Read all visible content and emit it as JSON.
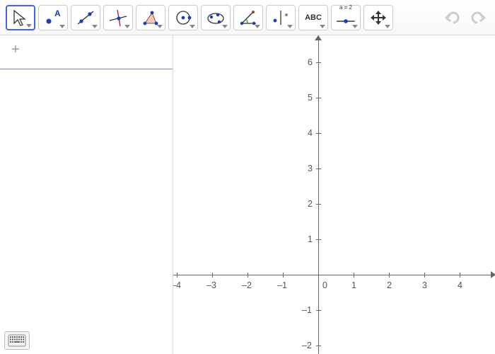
{
  "toolbar": {
    "tools": [
      {
        "name": "move-tool",
        "selected": true
      },
      {
        "name": "point-tool"
      },
      {
        "name": "line-tool"
      },
      {
        "name": "perpendicular-tool"
      },
      {
        "name": "polygon-tool"
      },
      {
        "name": "circle-tool"
      },
      {
        "name": "ellipse-tool"
      },
      {
        "name": "angle-tool"
      },
      {
        "name": "reflect-tool"
      },
      {
        "name": "text-tool",
        "label": "ABC"
      },
      {
        "name": "slider-tool",
        "label": "a = 2"
      },
      {
        "name": "move-view-tool"
      }
    ]
  },
  "chart_data": {
    "type": "scatter",
    "title": "",
    "xlabel": "",
    "ylabel": "",
    "xlim": [
      -4.5,
      4.5
    ],
    "ylim": [
      -2.5,
      6.5
    ],
    "xticks": [
      -4,
      -3,
      -2,
      -1,
      0,
      1,
      2,
      3,
      4
    ],
    "yticks": [
      -2,
      -1,
      1,
      2,
      3,
      4,
      5,
      6
    ],
    "series": []
  },
  "labels": {
    "zero": "0",
    "m4": "–4",
    "m3": "–3",
    "m2": "–2",
    "m1": "–1",
    "p1": "1",
    "p2": "2",
    "p3": "3",
    "p4": "4",
    "p5": "5",
    "p6": "6",
    "ym1": "–1",
    "ym2": "–2"
  }
}
